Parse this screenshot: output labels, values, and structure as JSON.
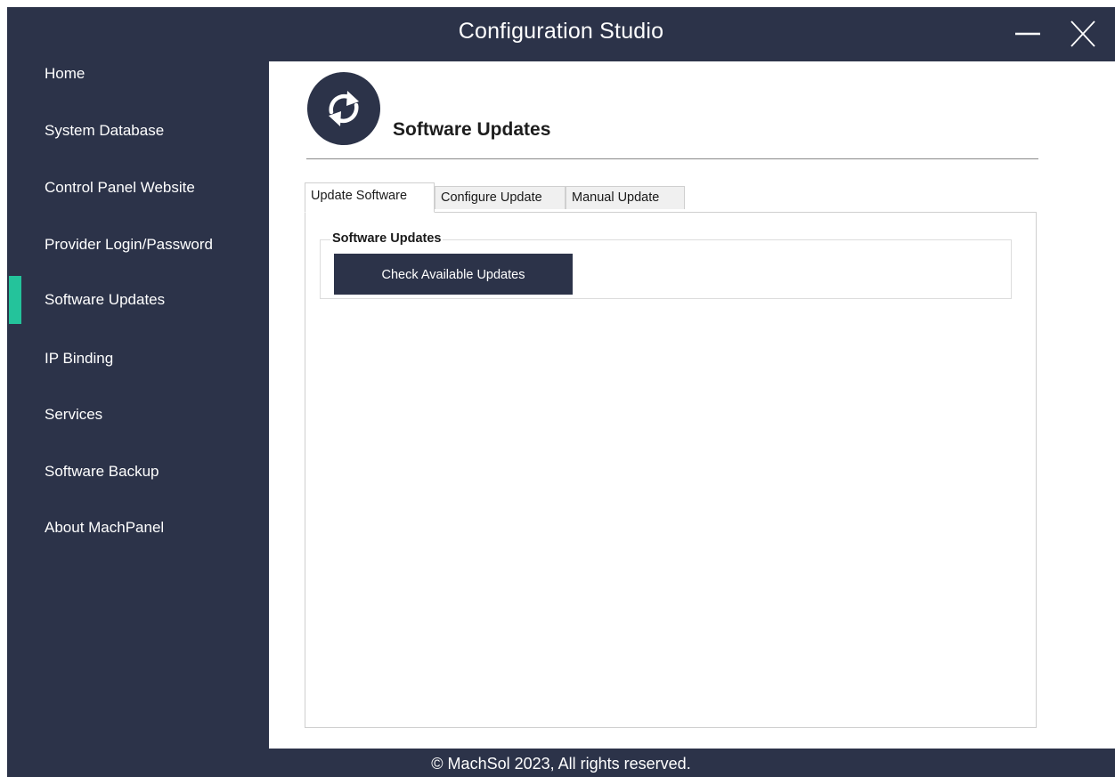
{
  "window": {
    "title": "Configuration Studio",
    "minimize_icon": "minimize-icon",
    "close_icon": "close-icon"
  },
  "sidebar": {
    "items": [
      {
        "label": "Home"
      },
      {
        "label": "System Database"
      },
      {
        "label": "Control Panel Website"
      },
      {
        "label": "Provider Login/Password"
      },
      {
        "label": "Software Updates",
        "selected": true
      },
      {
        "label": "IP Binding"
      },
      {
        "label": "Services"
      },
      {
        "label": "Software Backup"
      },
      {
        "label": "About MachPanel"
      }
    ]
  },
  "page": {
    "icon": "sync-icon",
    "title": "Software Updates"
  },
  "tabs": [
    {
      "label": "Update Software",
      "active": true
    },
    {
      "label": "Configure Update",
      "active": false
    },
    {
      "label": "Manual Update",
      "active": false
    }
  ],
  "panel": {
    "group_title": "Software Updates",
    "check_button": "Check Available Updates"
  },
  "footer": {
    "text": "© MachSol 2023, All rights reserved."
  },
  "colors": {
    "sidebar_bg": "#2c3349",
    "accent": "#24c39b",
    "button_bg": "#2c3349",
    "content_bg": "#ffffff"
  }
}
